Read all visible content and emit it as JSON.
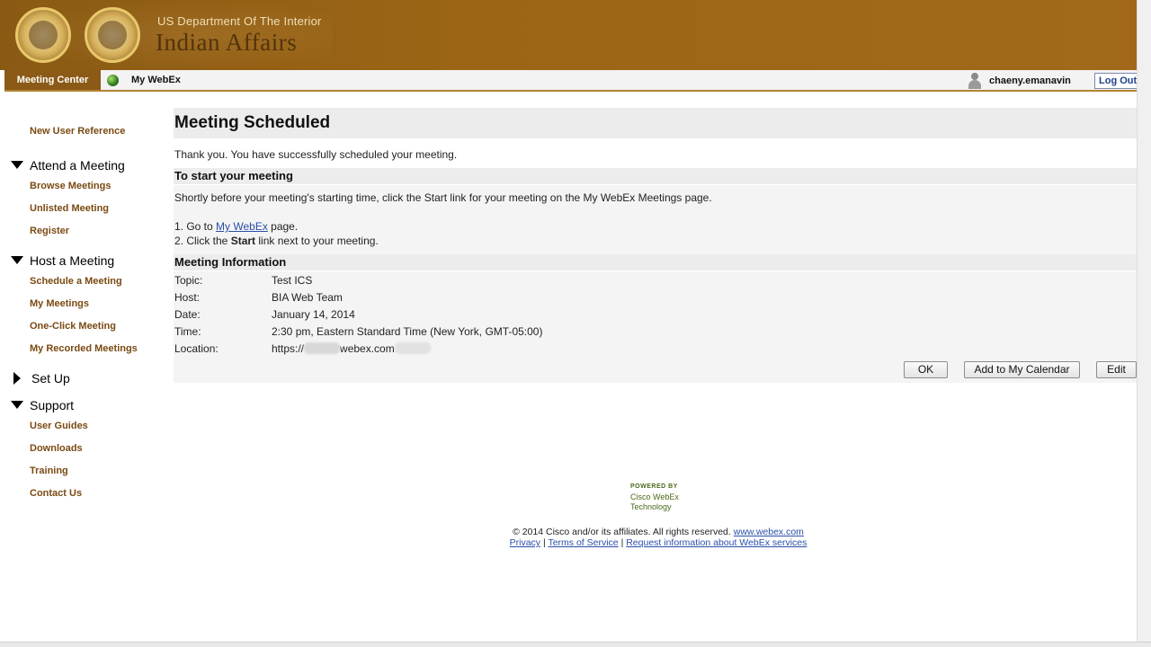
{
  "header": {
    "agency_top": "US Department Of The Interior",
    "agency_name": "Indian Affairs",
    "seal1_icon": "bia-seal-icon",
    "seal2_icon": "bison-seal-icon"
  },
  "nav": {
    "meeting_center": "Meeting Center",
    "my_webex": "My WebEx",
    "username": "chaeny.emanavin",
    "logout": "Log Out"
  },
  "sidebar": {
    "new_user_reference": "New User Reference",
    "attend_heading": "Attend a Meeting",
    "attend_items": [
      "Browse Meetings",
      "Unlisted Meeting",
      "Register"
    ],
    "host_heading": "Host a Meeting",
    "host_items": [
      "Schedule a Meeting",
      "My Meetings",
      "One-Click Meeting",
      "My Recorded Meetings"
    ],
    "setup_heading": "Set Up",
    "support_heading": "Support",
    "support_items": [
      "User Guides",
      "Downloads",
      "Training",
      "Contact Us"
    ]
  },
  "main": {
    "title": "Meeting Scheduled",
    "thank_you": "Thank you. You have successfully scheduled your meeting.",
    "start_heading": "To start your meeting",
    "start_instructions": "Shortly before your meeting's starting time, click the Start link for your meeting on the My WebEx Meetings page.",
    "step1_prefix": "1. Go to ",
    "step1_link": "My WebEx",
    "step1_suffix": " page.",
    "step2_prefix": "2. Click the ",
    "step2_bold": "Start",
    "step2_suffix": " link next to your meeting.",
    "info_heading": "Meeting Information",
    "info": {
      "topic_label": "Topic:",
      "topic": "Test ICS",
      "host_label": "Host:",
      "host": "BIA Web Team",
      "date_label": "Date:",
      "date": "January 14, 2014",
      "time_label": "Time:",
      "time": "2:30 pm, Eastern Standard Time (New York, GMT-05:00)",
      "location_label": "Location:",
      "location_prefix": "https://",
      "location_mid": "webex.com"
    },
    "buttons": {
      "ok": "OK",
      "add_calendar": "Add to My Calendar",
      "edit": "Edit"
    }
  },
  "footer": {
    "powered_by": "POWERED BY",
    "powered_line1": "Cisco WebEx",
    "powered_line2": "Technology",
    "copyright": "© 2014 Cisco and/or its affiliates. All rights reserved.",
    "webex_link": "www.webex.com",
    "privacy": "Privacy",
    "terms": "Terms of Service",
    "request_info": "Request information about WebEx services",
    "separator": "|"
  }
}
